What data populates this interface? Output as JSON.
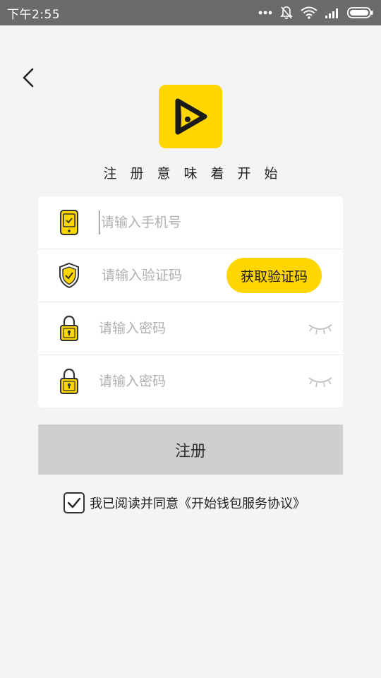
{
  "status_bar": {
    "time": "下午2:55"
  },
  "header": {
    "back_icon": "chevron-left-icon"
  },
  "logo": {
    "icon": "play-logo-icon",
    "bg_color": "#ffd600"
  },
  "slogan": "注册意味着开始",
  "form": {
    "phone": {
      "placeholder": "请输入手机号",
      "icon": "phone-icon"
    },
    "code": {
      "placeholder": "请输入验证码",
      "icon": "shield-icon",
      "button_label": "获取验证码"
    },
    "password": {
      "placeholder": "请输入密码",
      "icon": "lock-icon",
      "toggle_icon": "eye-closed-icon"
    },
    "password_confirm": {
      "placeholder": "请输入密码",
      "icon": "lock-icon",
      "toggle_icon": "eye-closed-icon"
    }
  },
  "register_button": "注册",
  "agreement": {
    "checked": true,
    "text": "我已阅读并同意",
    "link": "《开始钱包服务协议》"
  },
  "colors": {
    "accent": "#ffd600",
    "status_bar": "#6b6b6b",
    "background": "#f4f4f4",
    "button_disabled": "#cfcfcf"
  }
}
